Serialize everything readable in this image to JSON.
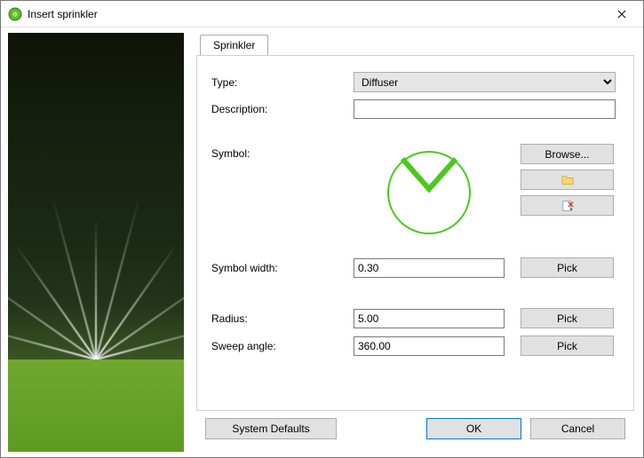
{
  "window": {
    "title": "Insert sprinkler"
  },
  "tab": {
    "label": "Sprinkler"
  },
  "labels": {
    "type": "Type:",
    "description": "Description:",
    "symbol": "Symbol:",
    "symbol_width": "Symbol width:",
    "radius": "Radius:",
    "sweep_angle": "Sweep angle:"
  },
  "type_select": {
    "value": "Diffuser",
    "options": [
      "Diffuser"
    ]
  },
  "description": {
    "value": ""
  },
  "symbol_width": {
    "value": "0.30"
  },
  "radius": {
    "value": "5.00"
  },
  "sweep_angle": {
    "value": "360.00"
  },
  "buttons": {
    "browse": "Browse...",
    "pick": "Pick",
    "system_defaults": "System Defaults",
    "ok": "OK",
    "cancel": "Cancel"
  },
  "icons": {
    "app": "sprinkler-app-icon",
    "close": "close-icon",
    "folder": "folder-icon",
    "delete": "delete-icon",
    "dropdown": "chevron-down-icon"
  },
  "symbol": {
    "shape": "circle-with-v",
    "color": "#49c91e"
  }
}
